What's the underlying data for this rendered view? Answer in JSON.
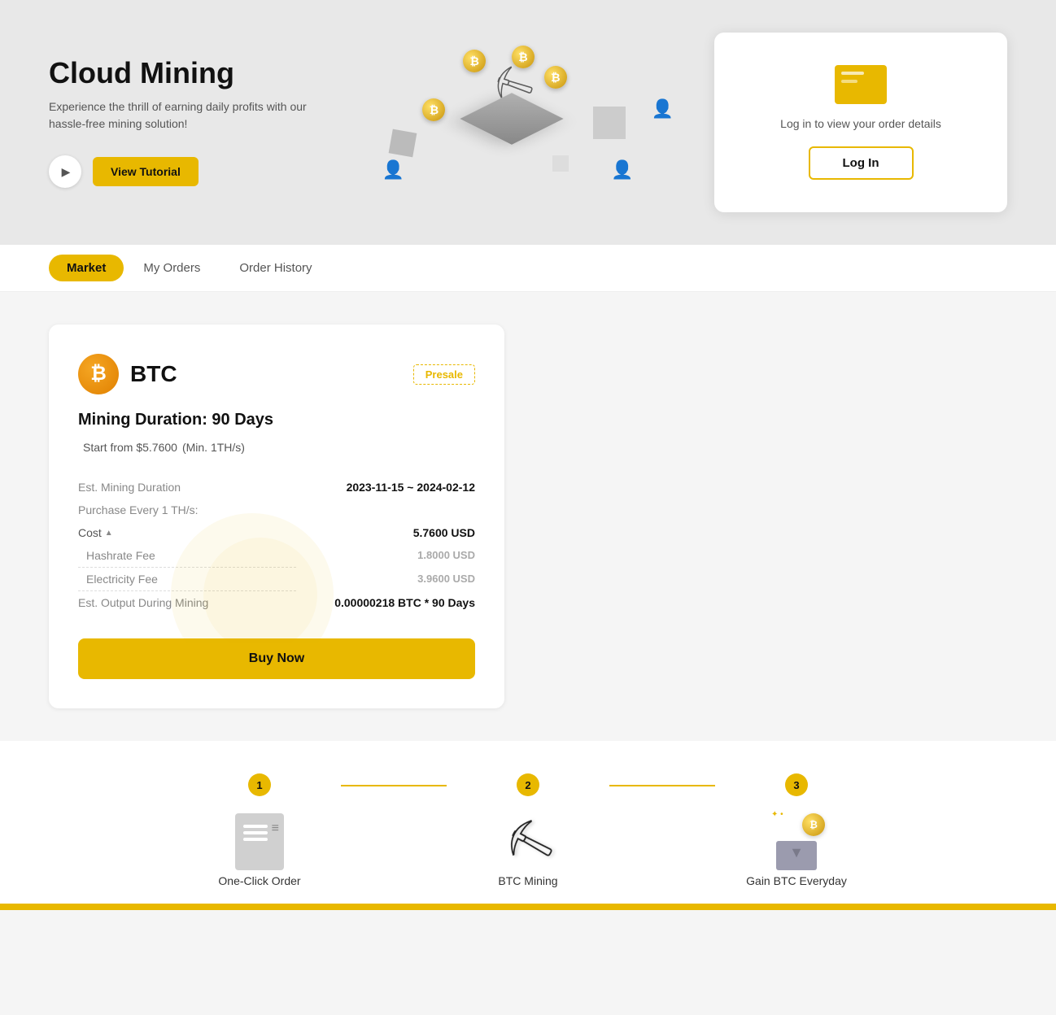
{
  "hero": {
    "title": "Cloud Mining",
    "subtitle": "Experience the thrill of earning daily profits with our hassle-free mining solution!",
    "view_tutorial_label": "View Tutorial",
    "play_icon": "▶"
  },
  "login_card": {
    "text": "Log in to view your order details",
    "login_label": "Log In",
    "icon_label": "order-details-icon"
  },
  "nav": {
    "tabs": [
      {
        "label": "Market",
        "active": true
      },
      {
        "label": "My Orders",
        "active": false
      },
      {
        "label": "Order History",
        "active": false
      }
    ]
  },
  "mining_card": {
    "coin": "₿",
    "coin_label": "BTC",
    "presale_label": "Presale",
    "duration_label": "Mining Duration: 90 Days",
    "start_from_label": "Start from $5.7600",
    "min_label": "(Min. 1TH/s)",
    "fields": {
      "est_mining_duration_label": "Est. Mining Duration",
      "est_mining_duration_value": "2023-11-15 ~ 2024-02-12",
      "purchase_label": "Purchase Every 1 TH/s:",
      "cost_label": "Cost",
      "cost_value": "5.7600 USD",
      "hashrate_fee_label": "Hashrate Fee",
      "hashrate_fee_value": "1.8000 USD",
      "electricity_fee_label": "Electricity Fee",
      "electricity_fee_value": "3.9600 USD",
      "est_output_label": "Est. Output During Mining",
      "est_output_value": "0.00000218 BTC * 90 Days"
    },
    "buy_now_label": "Buy Now"
  },
  "steps": [
    {
      "number": "1",
      "label": "One-Click Order",
      "icon": "doc"
    },
    {
      "number": "2",
      "label": "BTC Mining",
      "icon": "pickaxe"
    },
    {
      "number": "3",
      "label": "Gain BTC Everyday",
      "icon": "reward"
    }
  ]
}
